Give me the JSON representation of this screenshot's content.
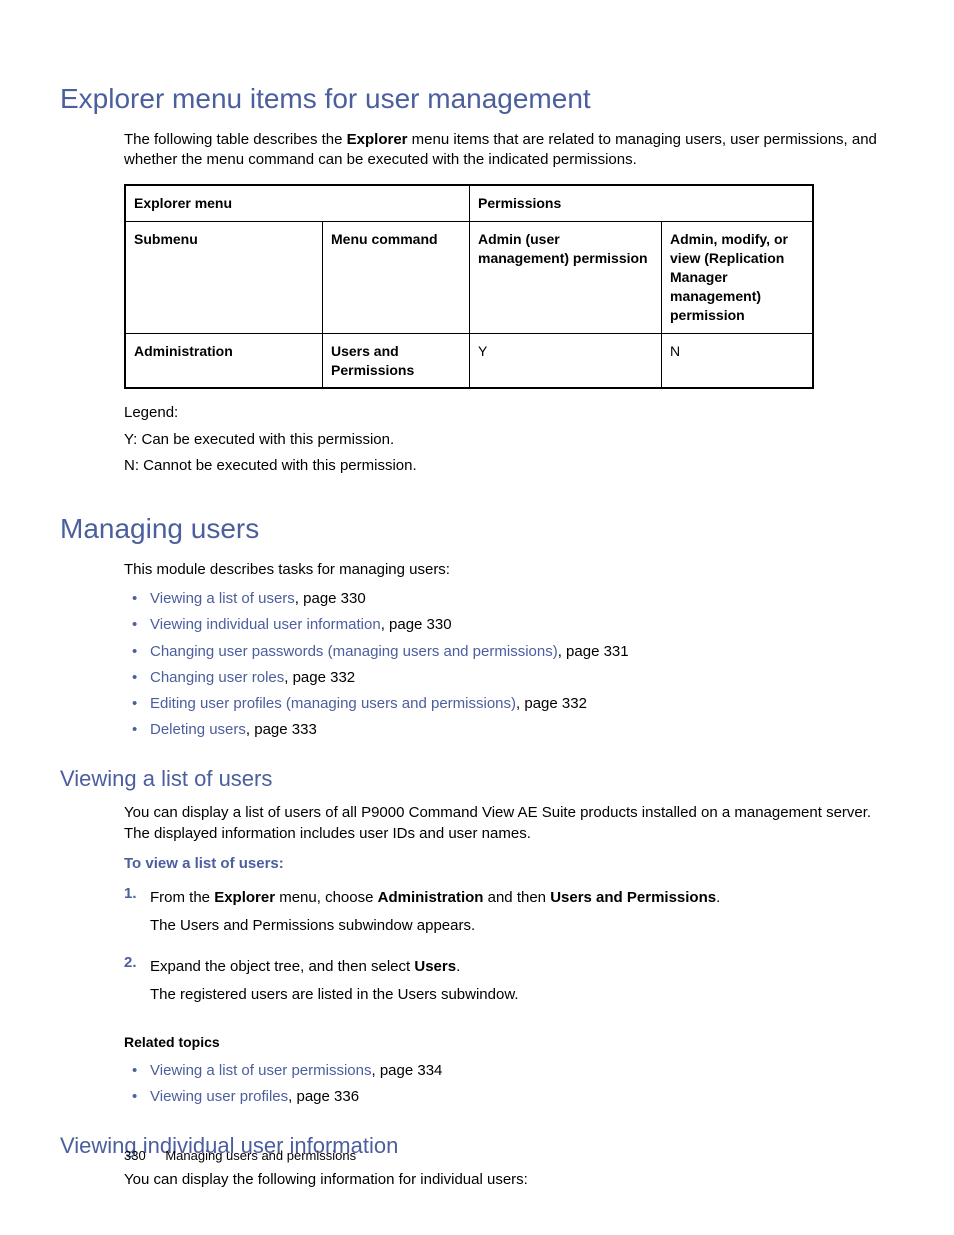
{
  "section1": {
    "title": "Explorer menu items for user management",
    "intro_pre": "The following table describes the ",
    "intro_bold": "Explorer",
    "intro_post": " menu items that are related to managing users, user permissions, and whether the menu command can be executed with the indicated permissions.",
    "table": {
      "row1_col1": "Explorer menu",
      "row1_col2": "Permissions",
      "row2_col1": "Submenu",
      "row2_col2": "Menu command",
      "row2_col3": "Admin (user management) permission",
      "row2_col4": "Admin, modify, or view (Replication Manager management) permission",
      "row3_col1": "Administration",
      "row3_col2": "Users and Permissions",
      "row3_col3": "Y",
      "row3_col4": "N"
    },
    "legend_label": "Legend:",
    "legend_y": "Y: Can be executed with this permission.",
    "legend_n": "N: Cannot be executed with this permission."
  },
  "section2": {
    "title": "Managing users",
    "intro": "This module describes tasks for managing users:",
    "items": [
      {
        "link": "Viewing a list of users",
        "page": ", page 330"
      },
      {
        "link": "Viewing individual user information",
        "page": ", page 330"
      },
      {
        "link": "Changing user passwords (managing users and permissions)",
        "page": ", page 331"
      },
      {
        "link": "Changing user roles",
        "page": ", page 332"
      },
      {
        "link": "Editing user profiles (managing users and permissions)",
        "page": ", page 332"
      },
      {
        "link": "Deleting users",
        "page": ", page 333"
      }
    ]
  },
  "section3": {
    "title": "Viewing a list of users",
    "intro": "You can display a list of users of all P9000 Command View AE Suite products installed on a management server. The displayed information includes user IDs and user names.",
    "steps_title": "To view a list of users:",
    "step1_num": "1.",
    "step1_p1_a": "From the ",
    "step1_p1_b": "Explorer",
    "step1_p1_c": " menu, choose ",
    "step1_p1_d": "Administration",
    "step1_p1_e": " and then ",
    "step1_p1_f": "Users and Permissions",
    "step1_p1_g": ".",
    "step1_p2": "The Users and Permissions subwindow appears.",
    "step2_num": "2.",
    "step2_p1_a": "Expand the object tree, and then select ",
    "step2_p1_b": "Users",
    "step2_p1_c": ".",
    "step2_p2": "The registered users are listed in the Users subwindow.",
    "related_label": "Related topics",
    "related": [
      {
        "link": "Viewing a list of user permissions",
        "page": ", page 334"
      },
      {
        "link": "Viewing user profiles",
        "page": ", page 336"
      }
    ]
  },
  "section4": {
    "title": "Viewing individual user information",
    "intro": "You can display the following information for individual users:"
  },
  "footer": {
    "page_number": "330",
    "title": "Managing users and permissions"
  }
}
